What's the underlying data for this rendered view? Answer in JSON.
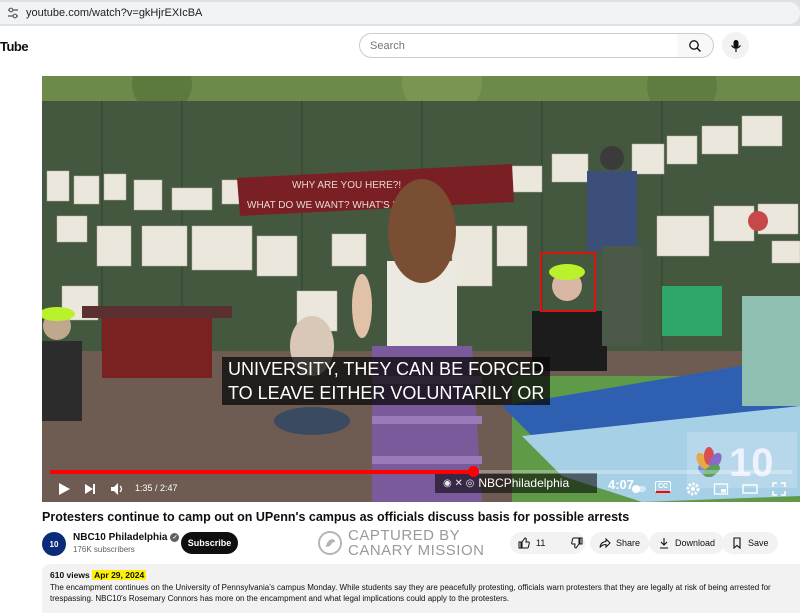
{
  "browser": {
    "url": "youtube.com/watch?v=gkHjrEXIcBA"
  },
  "header": {
    "logo_text": "Tube",
    "search_placeholder": "Search"
  },
  "video": {
    "caption_line1": "UNIVERSITY, THEY CAN BE FORCED",
    "caption_line2": "TO LEAVE EITHER VOLUNTARILY OR",
    "banner_line1": "WHY ARE YOU HERE?!",
    "banner_line2": "WHAT DO WE WANT? WHAT'S IN YOUR",
    "watermark_handle": "NBCPhiladelphia",
    "time_overlay": "4:07",
    "bug_number": "10",
    "progress_fraction": 0.57,
    "player": {
      "timecode": "1:35 / 2:47",
      "cc_label": "CC"
    }
  },
  "meta": {
    "title": "Protesters continue to camp out on UPenn's campus as officials discuss basis for possible arrests",
    "channel_name": "NBC10 Philadelphia",
    "avatar_text": "10",
    "subscribers": "176K subscribers",
    "subscribe_label": "Subscribe",
    "like_count": "11",
    "share_label": "Share",
    "download_label": "Download",
    "save_label": "Save"
  },
  "overlay": {
    "canary_line1": "CAPTURED BY",
    "canary_line2": "CANARY MISSION"
  },
  "description": {
    "views": "610 views",
    "date": "Apr 29, 2024",
    "text": "The encampment continues on the University of Pennsylvania's campus Monday. While students say they are peacefully protesting, officials warn protesters that they are legally at risk of being arrested for trespassing. NBC10's Rosemary Connors has more on the encampment and what legal implications could apply to the protesters."
  },
  "colors": {
    "accent": "#ff0000",
    "highlight": "#fff200",
    "subscribe_bg": "#0f0f0f"
  }
}
